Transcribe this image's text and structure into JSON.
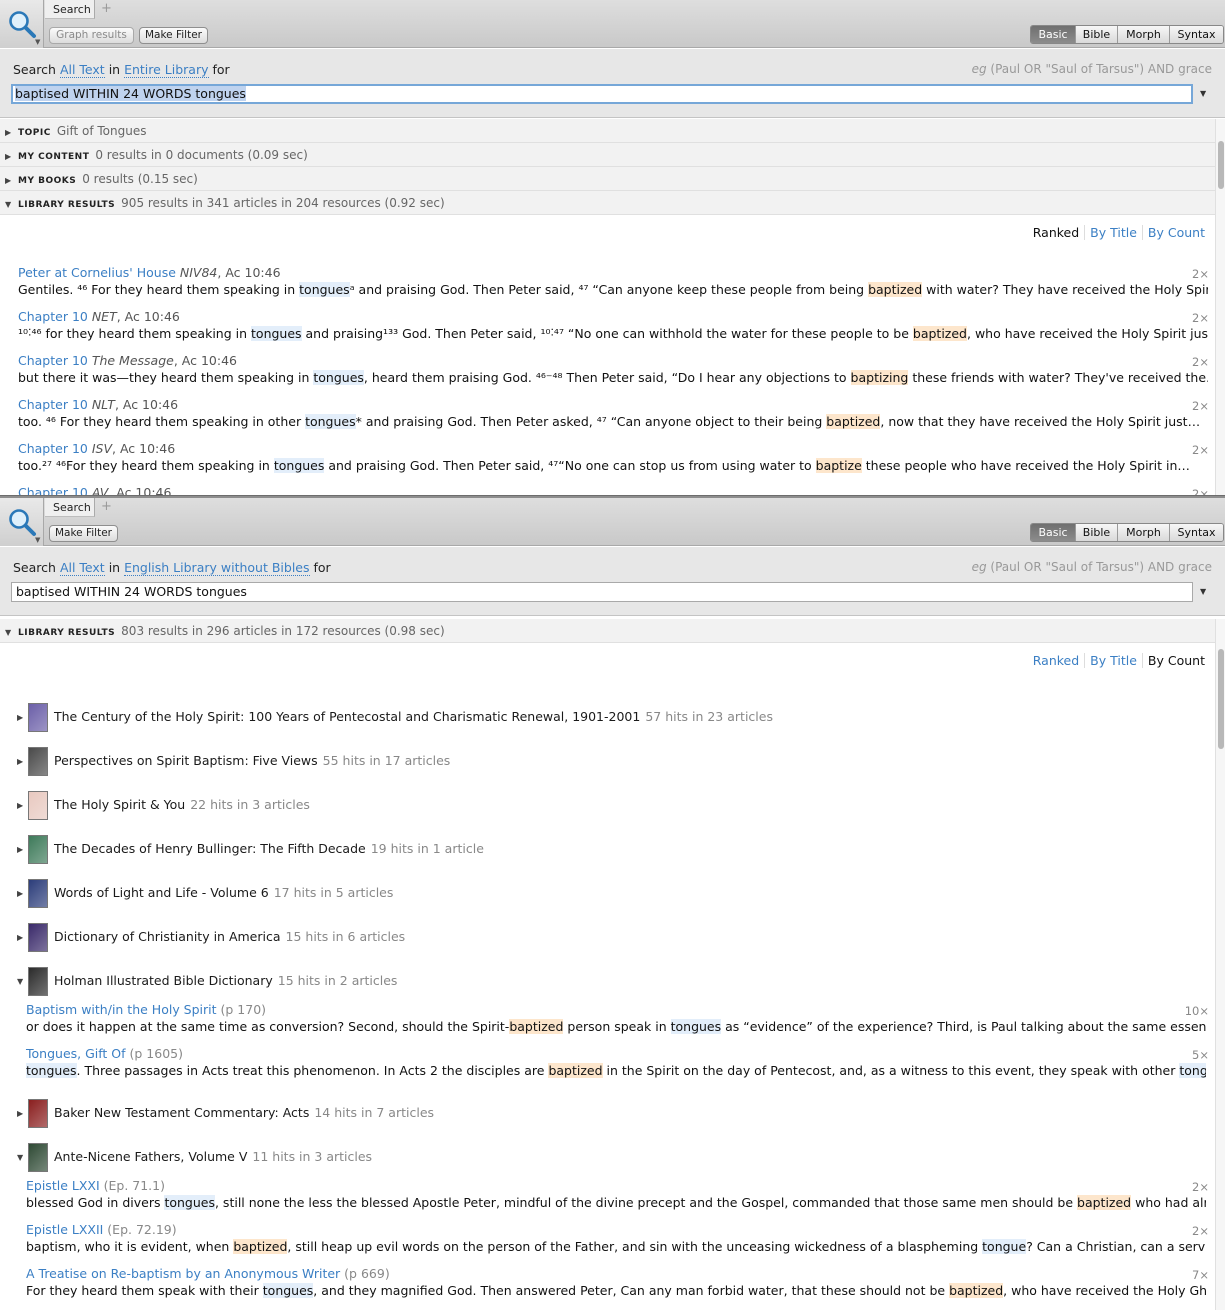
{
  "panel1": {
    "tab_label": "Search",
    "tab_add": "+",
    "buttons": {
      "graph": "Graph results",
      "filter": "Make Filter"
    },
    "modes": [
      "Basic",
      "Bible",
      "Morph",
      "Syntax"
    ],
    "active_mode": "Basic",
    "search_prefix": "Search",
    "search_scope_text": "All Text",
    "search_in": "in",
    "search_library": "Entire Library",
    "search_for": "for",
    "example_eg": "eg",
    "example_text": "(Paul OR \"Saul of Tarsus\") AND grace",
    "query": "baptised WITHIN 24 WORDS tongues",
    "sections": [
      {
        "label": "TOPIC",
        "value": "Gift of Tongues"
      },
      {
        "label": "MY CONTENT",
        "value": "0 results in 0 documents (0.09 sec)"
      },
      {
        "label": "MY BOOKS",
        "value": "0 results (0.15 sec)"
      },
      {
        "label": "LIBRARY RESULTS",
        "value": "905 results in 341 articles in 204 resources (0.92 sec)"
      }
    ],
    "sort": {
      "ranked": "Ranked",
      "title": "By Title",
      "count": "By Count",
      "active": "Ranked"
    },
    "results": [
      {
        "title": "Peter at Cornelius' House",
        "version": "NIV84",
        "ref": ", Ac 10:46",
        "count": "2×",
        "snippet": [
          [
            "Gentiles. ⁴⁶ For they heard them speaking in ",
            ""
          ],
          [
            "tongues",
            "b"
          ],
          [
            "ᵃ and praising God. Then Peter said, ⁴⁷ “Can anyone keep these people from being ",
            ""
          ],
          [
            "baptized",
            "o"
          ],
          [
            " with water? They have received the Holy Spirit…",
            ""
          ]
        ]
      },
      {
        "title": "Chapter 10",
        "version": "NET",
        "ref": ", Ac 10:46",
        "count": "2×",
        "snippet": [
          [
            "¹⁰˸⁴⁶ for they heard them speaking in ",
            ""
          ],
          [
            "tongues",
            "b"
          ],
          [
            " and praising¹³³ God. Then Peter said, ¹⁰˸⁴⁷ “No one can withhold the water for these people to be ",
            ""
          ],
          [
            "baptized",
            "o"
          ],
          [
            ", who have received the Holy Spirit just…",
            ""
          ]
        ]
      },
      {
        "title": "Chapter 10",
        "version": "The Message",
        "ref": ", Ac 10:46",
        "count": "2×",
        "snippet": [
          [
            "but there it was—they heard them speaking in ",
            ""
          ],
          [
            "tongues",
            "b"
          ],
          [
            ", heard them praising God.        ⁴⁶⁻⁴⁸     Then Peter said, “Do I hear any objections to ",
            ""
          ],
          [
            "baptizing",
            "o"
          ],
          [
            " these friends with water? They've received the…",
            ""
          ]
        ]
      },
      {
        "title": "Chapter 10",
        "version": "NLT",
        "ref": ", Ac 10:46",
        "count": "2×",
        "snippet": [
          [
            "too. ⁴⁶ For they heard them speaking in other ",
            ""
          ],
          [
            "tongues",
            "b"
          ],
          [
            "* and praising God. Then Peter asked, ⁴⁷ “Can anyone object to their being ",
            ""
          ],
          [
            "baptized",
            "o"
          ],
          [
            ", now that they have received the Holy Spirit just…",
            ""
          ]
        ]
      },
      {
        "title": "Chapter 10",
        "version": "ISV",
        "ref": ", Ac 10:46",
        "count": "2×",
        "snippet": [
          [
            "too.²⁷ ⁴⁶For they heard them speaking in ",
            ""
          ],
          [
            "tongues",
            "b"
          ],
          [
            " and praising God. Then Peter said, ⁴⁷“No one can stop us from using water to ",
            ""
          ],
          [
            "baptize",
            "o"
          ],
          [
            " these people who have received the Holy Spirit in…",
            ""
          ]
        ]
      },
      {
        "title": "Chapter 10",
        "version": "AV",
        "ref": ", Ac 10:46",
        "count": "2×",
        "snippet": []
      }
    ]
  },
  "panel2": {
    "tab_label": "Search",
    "tab_add": "+",
    "buttons": {
      "filter": "Make Filter"
    },
    "modes": [
      "Basic",
      "Bible",
      "Morph",
      "Syntax"
    ],
    "active_mode": "Basic",
    "search_prefix": "Search",
    "search_scope_text": "All Text",
    "search_in": "in",
    "search_library": "English Library without Bibles",
    "search_for": "for",
    "example_eg": "eg",
    "example_text": "(Paul OR \"Saul of Tarsus\") AND grace",
    "query": "baptised WITHIN 24 WORDS tongues",
    "section": {
      "label": "LIBRARY RESULTS",
      "value": "803 results in 296 articles in 172 resources (0.98 sec)"
    },
    "sort": {
      "ranked": "Ranked",
      "title": "By Title",
      "count": "By Count",
      "active": "By Count"
    },
    "books": [
      {
        "title": "The Century of the Holy Spirit: 100 Years of Pentecostal and Charismatic Renewal, 1901-2001",
        "hits": "57 hits in 23 articles",
        "cover": "#6b5fa8",
        "open": false
      },
      {
        "title": "Perspectives on Spirit Baptism: Five Views",
        "hits": "55 hits in 17 articles",
        "cover": "#4a4a4a",
        "open": false
      },
      {
        "title": "The Holy Spirit & You",
        "hits": "22 hits in 3 articles",
        "cover": "#e8c9c0",
        "open": false
      },
      {
        "title": "The Decades of Henry Bullinger: The Fifth Decade",
        "hits": "19 hits in 1 article",
        "cover": "#3e7a5a",
        "open": false
      },
      {
        "title": "Words of Light and Life - Volume 6",
        "hits": "17 hits in 5 articles",
        "cover": "#2c3d7a",
        "open": false
      },
      {
        "title": "Dictionary of Christianity in America",
        "hits": "15 hits in 6 articles",
        "cover": "#3a2a6a",
        "open": false
      },
      {
        "title": "Holman Illustrated Bible Dictionary",
        "hits": "15 hits in 2 articles",
        "cover": "#2b2b2b",
        "open": true,
        "articles": [
          {
            "title": "Baptism with/in the Holy Spirit",
            "page": "(p 170)",
            "count": "10×",
            "snippet": [
              [
                "or does it happen at the same time as conversion? Second, should the Spirit-",
                ""
              ],
              [
                "baptized",
                "o"
              ],
              [
                " person speak in ",
                ""
              ],
              [
                "tongues",
                "b"
              ],
              [
                " as “evidence” of the experience? Third, is Paul talking about the same essential…",
                ""
              ]
            ]
          },
          {
            "title": "Tongues, Gift Of",
            "page": "(p 1605)",
            "count": "5×",
            "snippet": [
              [
                "tongues",
                "b"
              ],
              [
                ". Three passages in Acts treat this phenomenon. In Acts 2 the disciples are ",
                ""
              ],
              [
                "baptized",
                "o"
              ],
              [
                " in the Spirit on the day of Pentecost, and, as a witness to this event, they speak with other ",
                ""
              ],
              [
                "tongues",
                "b"
              ],
              [
                "…",
                ""
              ]
            ]
          }
        ]
      },
      {
        "title": "Baker New Testament Commentary: Acts",
        "hits": "14 hits in 7 articles",
        "cover": "#8a1f1f",
        "open": false
      },
      {
        "title": "Ante-Nicene Fathers, Volume V",
        "hits": "11 hits in 3 articles",
        "cover": "#2f4a35",
        "open": true,
        "articles": [
          {
            "title": "Epistle LXXI",
            "page": "(Ep. 71.1)",
            "count": "2×",
            "snippet": [
              [
                "blessed God in divers ",
                ""
              ],
              [
                "tongues",
                "b"
              ],
              [
                ", still none the less the blessed Apostle Peter, mindful of the divine precept and the Gospel, commanded that those same men should be ",
                ""
              ],
              [
                "baptized",
                "o"
              ],
              [
                " who had already been…",
                ""
              ]
            ]
          },
          {
            "title": "Epistle LXXII",
            "page": "(Ep. 72.19)",
            "count": "2×",
            "snippet": [
              [
                "baptism, who it is evident, when ",
                ""
              ],
              [
                "baptized",
                "o"
              ],
              [
                ", still heap up evil words on the person of the Father, and sin with the unceasing wickedness of a blaspheming ",
                ""
              ],
              [
                "tongue",
                "b"
              ],
              [
                "? Can a Christian, can a servant of…",
                ""
              ]
            ]
          },
          {
            "title": "A Treatise on Re-baptism by an Anonymous Writer",
            "page": "(p 669)",
            "count": "7×",
            "snippet": [
              [
                "For they heard them speak with their ",
                ""
              ],
              [
                "tongues",
                "b"
              ],
              [
                ", and they magnified God. Then answered Peter, Can any man forbid water, that these should not be ",
                ""
              ],
              [
                "baptized",
                "o"
              ],
              [
                ", who have received the Holy Ghost as well…",
                ""
              ]
            ]
          }
        ]
      }
    ]
  }
}
